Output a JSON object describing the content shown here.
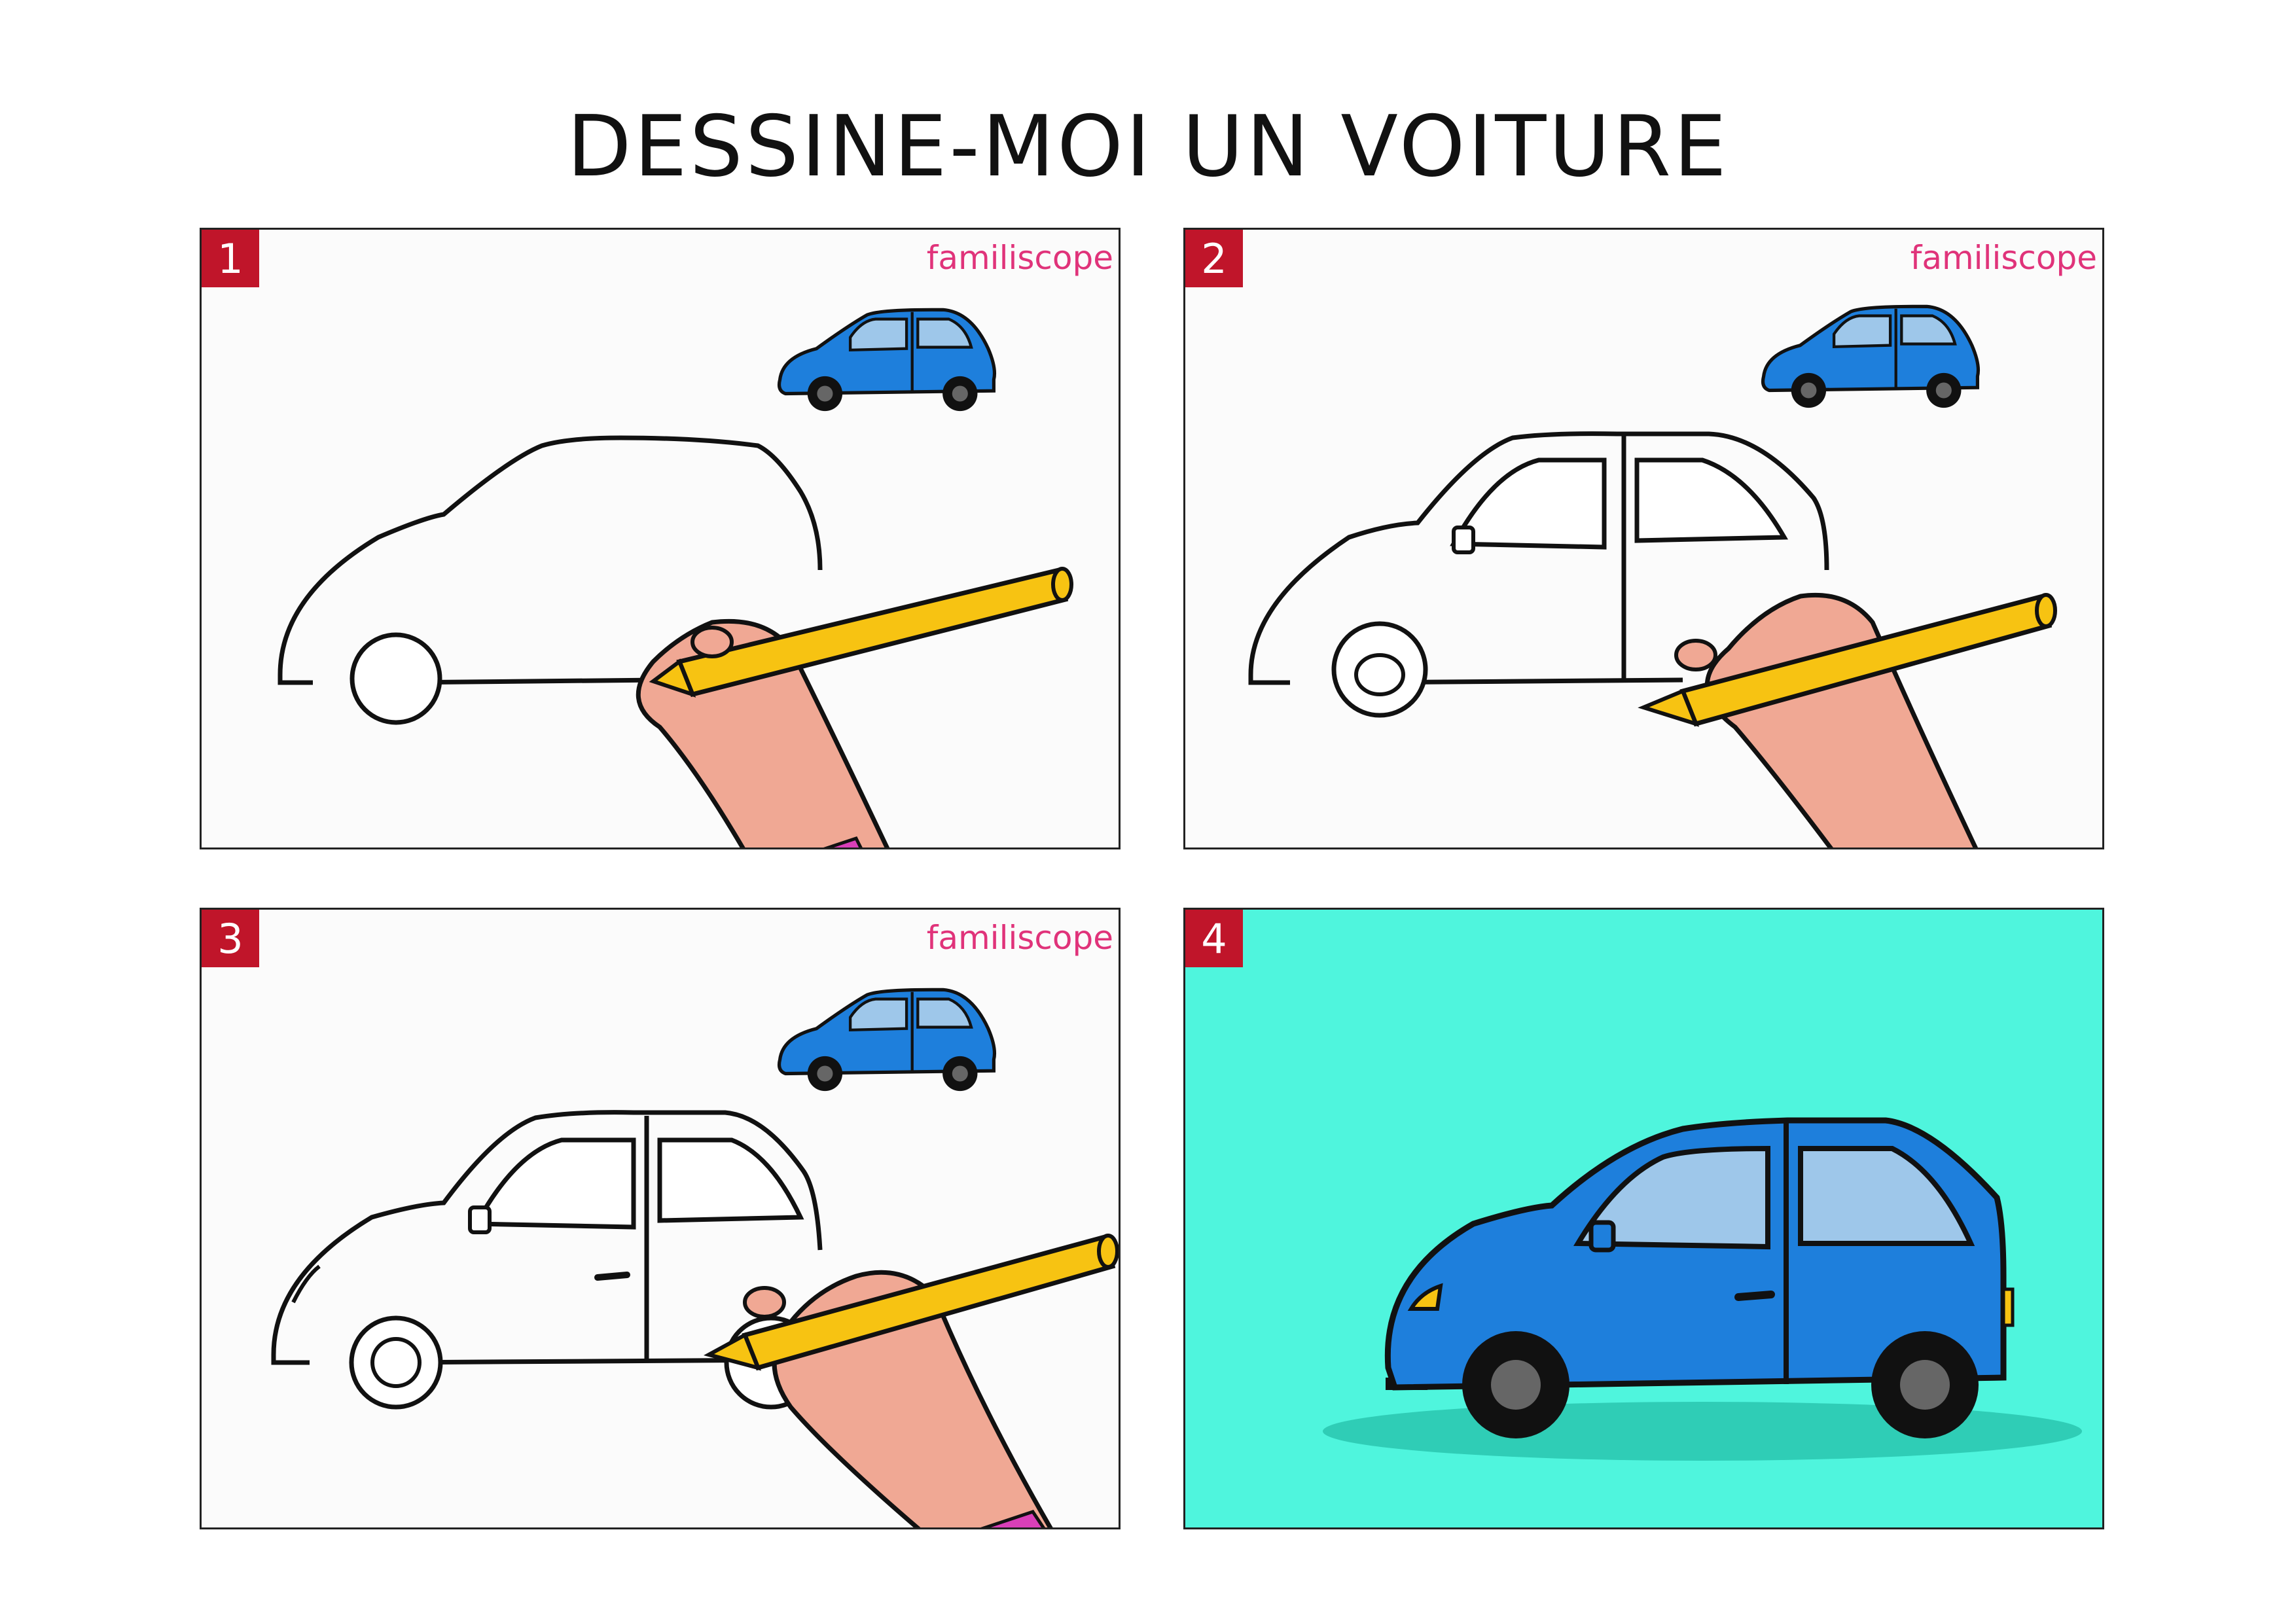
{
  "title": "DESSINE-MOI UN VOITURE",
  "brand": "familiscope",
  "panels": [
    {
      "number": "1",
      "background": "#fbfbfb"
    },
    {
      "number": "2",
      "background": "#fbfbfb"
    },
    {
      "number": "3",
      "background": "#fbfbfb"
    },
    {
      "number": "4",
      "background": "#4ff5dd"
    }
  ],
  "colors": {
    "badge": "#c0152a",
    "brand": "#e0337a",
    "car_body": "#1e7fdc",
    "car_window": "#9ec7ea",
    "pencil": "#f7c312",
    "skin": "#f0a894",
    "shadow": "#2fcdb6"
  }
}
